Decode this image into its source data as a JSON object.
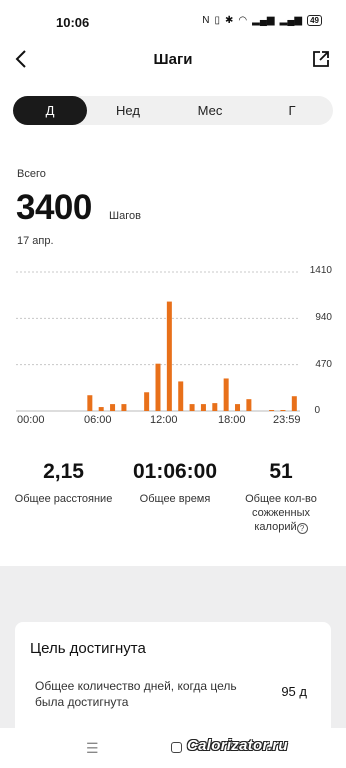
{
  "status_bar": {
    "time": "10:06",
    "battery": "49"
  },
  "header": {
    "title": "Шаги"
  },
  "tabs": [
    {
      "label": "Д",
      "active": true
    },
    {
      "label": "Нед",
      "active": false
    },
    {
      "label": "Мес",
      "active": false
    },
    {
      "label": "Г",
      "active": false
    }
  ],
  "summary": {
    "label": "Всего",
    "value": "3400",
    "unit": "Шагов",
    "date": "17 апр."
  },
  "chart_data": {
    "type": "bar",
    "x_ticks": [
      "00:00",
      "06:00",
      "12:00",
      "18:00",
      "23:59"
    ],
    "y_ticks": [
      "1410",
      "940",
      "470",
      "0"
    ],
    "ylim": [
      0,
      1410
    ],
    "bar_color": "#e8701a",
    "values": [
      0,
      0,
      0,
      0,
      0,
      0,
      160,
      40,
      70,
      70,
      0,
      190,
      480,
      1110,
      300,
      70,
      70,
      80,
      330,
      70,
      120,
      0,
      10,
      10,
      150
    ]
  },
  "stats": {
    "distance": {
      "value": "2,15",
      "label": "Общее расстояние"
    },
    "time": {
      "value": "01:06:00",
      "label": "Общее время"
    },
    "calories": {
      "value": "51",
      "label_line1": "Общее кол-во",
      "label_line2": "сожженных",
      "label_line3": "калорий"
    }
  },
  "goal": {
    "title": "Цель достигнута",
    "desc": "Общее количество дней, когда цель была достигнута",
    "value": "95 д"
  },
  "watermark": "Calorizator.ru"
}
